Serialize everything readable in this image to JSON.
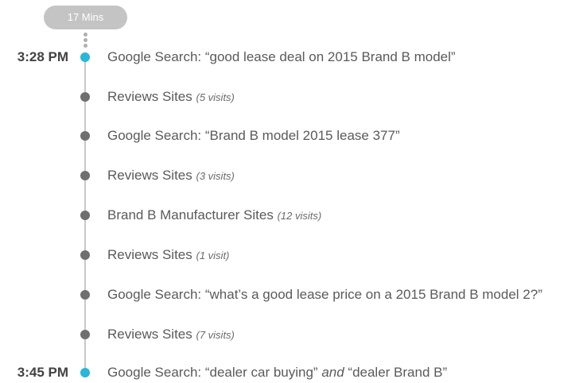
{
  "duration_badge": "17 Mins",
  "colors": {
    "accent": "#29b6d8",
    "node": "#6f6f6f",
    "line": "#c8c8c8",
    "badge": "#c4c4c4"
  },
  "events": [
    {
      "time": "3:28 PM",
      "text": "Google Search: “good lease deal on 2015 Brand B model”",
      "note": ""
    },
    {
      "time": "",
      "text": "Reviews Sites",
      "note": "(5 visits)"
    },
    {
      "time": "",
      "text": "Google Search: “Brand B model 2015 lease 377”",
      "note": ""
    },
    {
      "time": "",
      "text": "Reviews Sites",
      "note": "(3 visits)"
    },
    {
      "time": "",
      "text": "Brand B Manufacturer Sites",
      "note": "(12 visits)"
    },
    {
      "time": "",
      "text": "Reviews Sites",
      "note": "(1 visit)"
    },
    {
      "time": "",
      "text": "Google Search: “what’s a good lease price on a 2015 Brand B model 2?”",
      "note": ""
    },
    {
      "time": "",
      "text": "Reviews Sites",
      "note": "(7 visits)"
    },
    {
      "time": "3:45 PM",
      "text_before": "Google Search: “dealer car buying” ",
      "text_italic": "and",
      "text_after": " “dealer Brand B”"
    }
  ]
}
